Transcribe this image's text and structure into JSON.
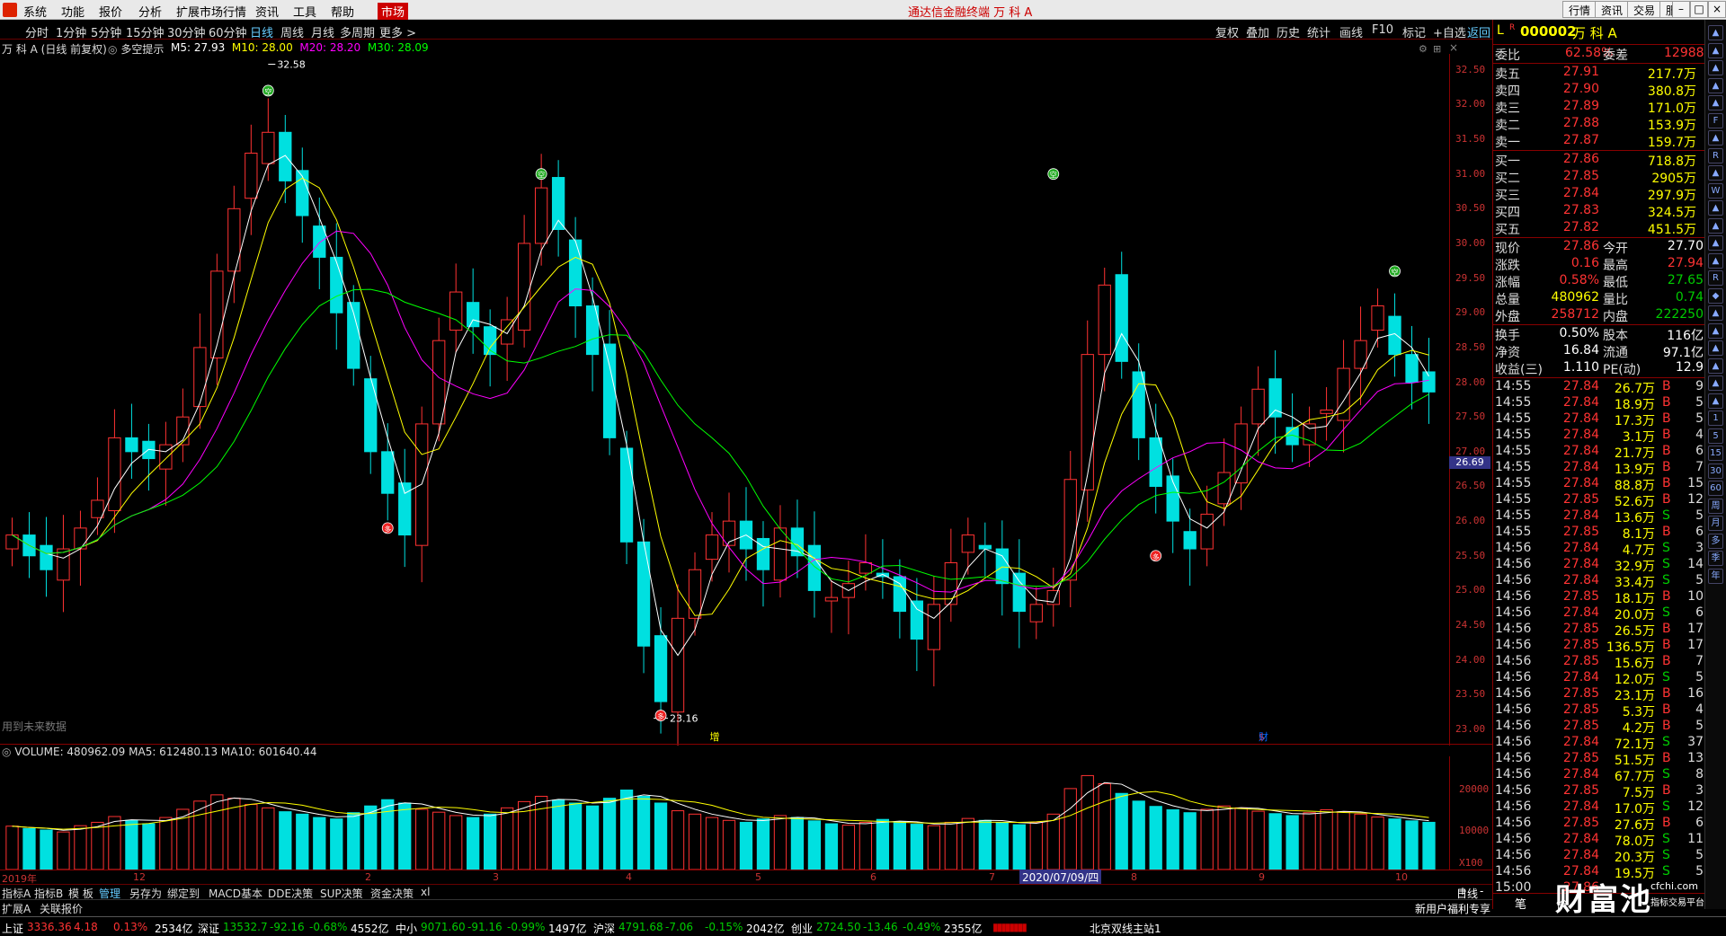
{
  "app": {
    "menus": [
      "系统",
      "功能",
      "报价",
      "分析",
      "扩展市场行情",
      "资讯",
      "工具",
      "帮助"
    ],
    "active_menu": "市场",
    "title": "通达信金融终端  万 科 A",
    "right_buttons": [
      "行情",
      "资讯",
      "交易",
      "服务"
    ]
  },
  "periods": [
    "分时",
    "1分钟",
    "5分钟",
    "15分钟",
    "30分钟",
    "60分钟",
    "日线",
    "周线",
    "月线",
    "多周期",
    "更多 >"
  ],
  "active_period": "日线",
  "tools": [
    "复权",
    "叠加",
    "历史",
    "统计",
    "画线",
    "F10",
    "标记",
    "+自选",
    "返回"
  ],
  "chart": {
    "stock_label": "万 科 A (日线 前复权)",
    "hint": "多空提示",
    "ma": [
      {
        "name": "M5",
        "value": "27.93",
        "color": "#ffffff"
      },
      {
        "name": "M10",
        "value": "28.00",
        "color": "#ffff00"
      },
      {
        "name": "M20",
        "value": "28.20",
        "color": "#ff00ff"
      },
      {
        "name": "M30",
        "value": "28.09",
        "color": "#00ff00"
      }
    ],
    "high_label": "32.58",
    "low_label": "23.16",
    "current_price_tag": "26.69",
    "no_future": "用到未来数据",
    "events": [
      "增",
      "$",
      "财"
    ],
    "y_ticks": [
      "32.50",
      "32.00",
      "31.50",
      "31.00",
      "30.50",
      "30.00",
      "29.50",
      "29.00",
      "28.50",
      "28.00",
      "27.50",
      "27.00",
      "26.50",
      "26.00",
      "25.50",
      "25.00",
      "24.50",
      "24.00",
      "23.50",
      "23.00"
    ],
    "x_labels": [
      "2019年",
      "12",
      "2",
      "3",
      "4",
      "5",
      "6",
      "7",
      "8",
      "9",
      "10"
    ],
    "date_cursor": "2020/07/09/四",
    "badges": [
      "空",
      "空",
      "空",
      "空",
      "多",
      "多",
      "多"
    ]
  },
  "volume": {
    "label": "VOLUME: 480962.09  MA5: 612480.13  MA10: 601640.44",
    "ticks": [
      "20000",
      "10000",
      "X100"
    ]
  },
  "chart_data": {
    "type": "candlestick",
    "title": "万 科 A (日线 前复权)",
    "ylim": [
      23.0,
      32.6
    ],
    "series": [
      {
        "name": "M5",
        "last": 27.93
      },
      {
        "name": "M10",
        "last": 28.0
      },
      {
        "name": "M20",
        "last": 28.2
      },
      {
        "name": "M30",
        "last": 28.09
      }
    ],
    "close_path": [
      25.8,
      25.5,
      25.3,
      25.6,
      25.9,
      26.3,
      27.2,
      27.0,
      26.9,
      27.1,
      27.5,
      28.5,
      29.6,
      30.5,
      31.3,
      31.6,
      30.9,
      30.4,
      29.8,
      29.0,
      28.2,
      27.0,
      26.4,
      25.8,
      27.4,
      28.6,
      29.3,
      28.8,
      28.4,
      28.9,
      30.0,
      30.8,
      30.2,
      29.1,
      28.4,
      27.2,
      25.7,
      24.2,
      23.4,
      24.6,
      25.3,
      25.8,
      26.0,
      25.6,
      25.3,
      25.9,
      25.5,
      25.0,
      24.9,
      25.1,
      25.4,
      25.2,
      24.7,
      24.3,
      24.8,
      25.4,
      25.8,
      25.6,
      25.1,
      24.7,
      24.8,
      25.0,
      26.6,
      28.4,
      29.4,
      28.3,
      27.2,
      26.5,
      26.0,
      25.6,
      26.1,
      26.7,
      27.4,
      27.9,
      27.5,
      27.1,
      27.4,
      27.6,
      28.2,
      28.6,
      29.1,
      28.4,
      28.0,
      27.86
    ]
  },
  "volume_data": [
    9000,
    8500,
    8200,
    7800,
    9100,
    9800,
    11000,
    10200,
    9500,
    10800,
    12500,
    14200,
    15500,
    14800,
    13500,
    12800,
    12000,
    11500,
    10800,
    10500,
    11800,
    13200,
    14500,
    13800,
    12500,
    11900,
    11200,
    10800,
    11500,
    12800,
    14100,
    15200,
    14400,
    13800,
    13200,
    14800,
    16500,
    15200,
    13800,
    12200,
    11500,
    10800,
    10200,
    9800,
    10500,
    11200,
    10800,
    10100,
    9500,
    9200,
    9800,
    10400,
    9900,
    9400,
    9100,
    9800,
    10600,
    10200,
    9700,
    9300,
    9800,
    11500,
    16800,
    19500,
    17800,
    15800,
    14200,
    13100,
    12400,
    11800,
    12500,
    13200,
    12800,
    12100,
    11600,
    11200,
    11800,
    12400,
    12000,
    11500,
    10900,
    10500,
    10100,
    9800
  ],
  "quote": {
    "market_tag": "L",
    "code": "000002",
    "name": "万 科 A",
    "weibi_label": "委比",
    "weibi": "62.58%",
    "weicha_label": "委差",
    "weicha": "12988",
    "asks": [
      {
        "label": "卖五",
        "price": "27.91",
        "vol": "217.7万"
      },
      {
        "label": "卖四",
        "price": "27.90",
        "vol": "380.8万"
      },
      {
        "label": "卖三",
        "price": "27.89",
        "vol": "171.0万"
      },
      {
        "label": "卖二",
        "price": "27.88",
        "vol": "153.9万"
      },
      {
        "label": "卖一",
        "price": "27.87",
        "vol": "159.7万"
      }
    ],
    "bids": [
      {
        "label": "买一",
        "price": "27.86",
        "vol": "718.8万"
      },
      {
        "label": "买二",
        "price": "27.85",
        "vol": "2905万"
      },
      {
        "label": "买三",
        "price": "27.84",
        "vol": "297.9万"
      },
      {
        "label": "买四",
        "price": "27.83",
        "vol": "324.5万"
      },
      {
        "label": "买五",
        "price": "27.82",
        "vol": "451.5万"
      }
    ],
    "stats": [
      {
        "l1": "现价",
        "v1": "27.86",
        "c1": "#ff3333",
        "l2": "今开",
        "v2": "27.70",
        "c2": "#ffffff"
      },
      {
        "l1": "涨跌",
        "v1": "0.16",
        "c1": "#ff3333",
        "l2": "最高",
        "v2": "27.94",
        "c2": "#ff3333"
      },
      {
        "l1": "涨幅",
        "v1": "0.58%",
        "c1": "#ff3333",
        "l2": "最低",
        "v2": "27.65",
        "c2": "#00cc00"
      },
      {
        "l1": "总量",
        "v1": "480962",
        "c1": "#ffff00",
        "l2": "量比",
        "v2": "0.74",
        "c2": "#00cc00"
      },
      {
        "l1": "外盘",
        "v1": "258712",
        "c1": "#ff3333",
        "l2": "内盘",
        "v2": "222250",
        "c2": "#00cc00"
      }
    ],
    "stats2": [
      {
        "l1": "换手",
        "v1": "0.50%",
        "l2": "股本",
        "v2": "116亿"
      },
      {
        "l1": "净资",
        "v1": "16.84",
        "l2": "流通",
        "v2": "97.1亿"
      },
      {
        "l1": "收益(三)",
        "v1": "1.110",
        "l2": "PE(动)",
        "v2": "12.9"
      }
    ],
    "ticks": [
      {
        "t": "14:55",
        "p": "27.84",
        "v": "26.7万",
        "d": "B",
        "n": "9"
      },
      {
        "t": "14:55",
        "p": "27.84",
        "v": "18.9万",
        "d": "B",
        "n": "5"
      },
      {
        "t": "14:55",
        "p": "27.84",
        "v": "17.3万",
        "d": "B",
        "n": "5"
      },
      {
        "t": "14:55",
        "p": "27.84",
        "v": "3.1万",
        "d": "B",
        "n": "4"
      },
      {
        "t": "14:55",
        "p": "27.84",
        "v": "21.7万",
        "d": "B",
        "n": "6"
      },
      {
        "t": "14:55",
        "p": "27.84",
        "v": "13.9万",
        "d": "B",
        "n": "7"
      },
      {
        "t": "14:55",
        "p": "27.84",
        "v": "88.8万",
        "d": "B",
        "n": "15"
      },
      {
        "t": "14:55",
        "p": "27.85",
        "v": "52.6万",
        "d": "B",
        "n": "12"
      },
      {
        "t": "14:55",
        "p": "27.84",
        "v": "13.6万",
        "d": "S",
        "n": "5"
      },
      {
        "t": "14:55",
        "p": "27.85",
        "v": "8.1万",
        "d": "B",
        "n": "6"
      },
      {
        "t": "14:56",
        "p": "27.84",
        "v": "4.7万",
        "d": "S",
        "n": "3"
      },
      {
        "t": "14:56",
        "p": "27.84",
        "v": "32.9万",
        "d": "S",
        "n": "14"
      },
      {
        "t": "14:56",
        "p": "27.84",
        "v": "33.4万",
        "d": "S",
        "n": "5"
      },
      {
        "t": "14:56",
        "p": "27.85",
        "v": "18.1万",
        "d": "B",
        "n": "10"
      },
      {
        "t": "14:56",
        "p": "27.84",
        "v": "20.0万",
        "d": "S",
        "n": "6"
      },
      {
        "t": "14:56",
        "p": "27.85",
        "v": "26.5万",
        "d": "B",
        "n": "17"
      },
      {
        "t": "14:56",
        "p": "27.85",
        "v": "136.5万",
        "d": "B",
        "n": "17"
      },
      {
        "t": "14:56",
        "p": "27.85",
        "v": "15.6万",
        "d": "B",
        "n": "7"
      },
      {
        "t": "14:56",
        "p": "27.84",
        "v": "12.0万",
        "d": "S",
        "n": "5"
      },
      {
        "t": "14:56",
        "p": "27.85",
        "v": "23.1万",
        "d": "B",
        "n": "16"
      },
      {
        "t": "14:56",
        "p": "27.85",
        "v": "5.3万",
        "d": "B",
        "n": "4"
      },
      {
        "t": "14:56",
        "p": "27.85",
        "v": "4.2万",
        "d": "B",
        "n": "5"
      },
      {
        "t": "14:56",
        "p": "27.84",
        "v": "72.1万",
        "d": "S",
        "n": "37"
      },
      {
        "t": "14:56",
        "p": "27.85",
        "v": "51.5万",
        "d": "B",
        "n": "13"
      },
      {
        "t": "14:56",
        "p": "27.84",
        "v": "67.7万",
        "d": "S",
        "n": "8"
      },
      {
        "t": "14:56",
        "p": "27.85",
        "v": "7.5万",
        "d": "B",
        "n": "3"
      },
      {
        "t": "14:56",
        "p": "27.84",
        "v": "17.0万",
        "d": "S",
        "n": "12"
      },
      {
        "t": "14:56",
        "p": "27.85",
        "v": "27.6万",
        "d": "B",
        "n": "6"
      },
      {
        "t": "14:56",
        "p": "27.84",
        "v": "78.0万",
        "d": "S",
        "n": "11"
      },
      {
        "t": "14:56",
        "p": "27.84",
        "v": "20.3万",
        "d": "S",
        "n": "5"
      },
      {
        "t": "14:56",
        "p": "27.84",
        "v": "19.5万",
        "d": "S",
        "n": "5"
      },
      {
        "t": "15:00",
        "p": "27.86",
        "v": "",
        "d": "",
        "n": ""
      }
    ]
  },
  "right_icons": [
    "▲",
    "▲",
    "▲",
    "▲",
    "▲",
    "F",
    "▲",
    "R",
    "▲",
    "W",
    "▲",
    "▲",
    "▲",
    "▲",
    "R",
    "◆",
    "▲",
    "▲",
    "▲",
    "▲",
    "▲",
    "▲",
    "1",
    "5",
    "15",
    "30",
    "60",
    "周",
    "月",
    "多",
    "季",
    "年"
  ],
  "bottom_tabs": [
    "指标A",
    "指标B",
    "模 板",
    "管理",
    "另存为",
    "绑定到",
    "MACD基本",
    "DDE决策",
    "SUP决策",
    "资金决策",
    "xl"
  ],
  "active_tab": "管理",
  "bottom_tabs2": [
    "扩展A",
    "关联报价"
  ],
  "right_bottom": {
    "period": "日线",
    "zoom_plus": "+",
    "zoom_minus": "-",
    "promo": "新用户福利专享",
    "bi": "笔",
    "price_label": "价"
  },
  "status": [
    {
      "name": "上证",
      "val": "3336.36",
      "chg": "4.18",
      "pct": "0.13%",
      "amt": "2534亿",
      "up": true
    },
    {
      "name": "深证",
      "val": "13532.7",
      "chg": "-92.16",
      "pct": "-0.68%",
      "amt": "4552亿",
      "up": false
    },
    {
      "name": "中小",
      "val": "9071.60",
      "chg": "-91.16",
      "pct": "-0.99%",
      "amt": "1497亿",
      "up": false
    },
    {
      "name": "沪深",
      "val": "4791.68",
      "chg": "-7.06",
      "pct": "-0.15%",
      "amt": "2042亿",
      "up": false
    },
    {
      "name": "创业",
      "val": "2724.50",
      "chg": "-13.46",
      "pct": "-0.49%",
      "amt": "2355亿",
      "up": false
    }
  ],
  "server": "北京双线主站1",
  "watermark": "财富池",
  "watermark_url": "cfchi.com",
  "watermark_sub": "指标交易平台"
}
